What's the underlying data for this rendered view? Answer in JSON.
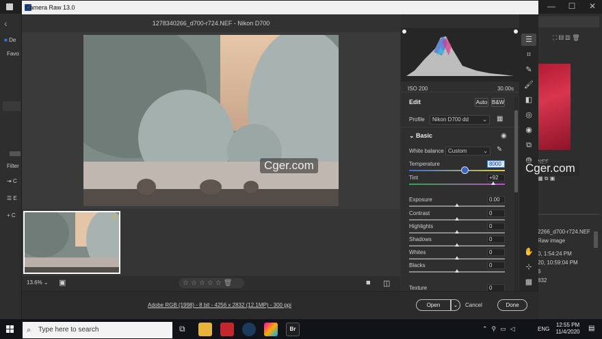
{
  "window": {
    "title": "Camera Raw 13.0",
    "filename": "1278340266_d700-r724.NEF  -  Nikon D700"
  },
  "bridge": {
    "left_items": [
      "De",
      "Favo",
      "Filter",
      "C",
      "E",
      "C"
    ],
    "right_meta": [
      "2266_d700-r724.NEF",
      "Raw image",
      "0, 1:54:24 PM",
      "20, 10:59:04 PM",
      "6",
      "832"
    ],
    "thumb_caption": "NEF"
  },
  "watermark": "Cger.com",
  "filmstrip": {
    "zoom": "13.6%",
    "stars": [
      "☆",
      "☆",
      "☆",
      "☆",
      "☆"
    ]
  },
  "histogram": {
    "iso": "ISO 200",
    "shutter": "30.00s"
  },
  "edit": {
    "heading": "Edit",
    "auto": "Auto",
    "bw": "B&W",
    "profile_label": "Profile",
    "profile_value": "Nikon D700 dd",
    "basic_label": "Basic",
    "wb_label": "White balance",
    "wb_value": "Custom",
    "temperature": {
      "label": "Temperature",
      "value": "8000",
      "level": 0.66
    },
    "tint": {
      "label": "Tint",
      "value": "+92",
      "level": 0.96
    },
    "exposure": {
      "label": "Exposure",
      "value": "0.00",
      "level": 0.5
    },
    "contrast": {
      "label": "Contrast",
      "value": "0",
      "level": 0.5
    },
    "highlights": {
      "label": "Highlights",
      "value": "0",
      "level": 0.5
    },
    "shadows": {
      "label": "Shadows",
      "value": "0",
      "level": 0.5
    },
    "whites": {
      "label": "Whites",
      "value": "0",
      "level": 0.5
    },
    "blacks": {
      "label": "Blacks",
      "value": "0",
      "level": 0.5
    },
    "texture": {
      "label": "Texture",
      "value": "0"
    }
  },
  "footer": {
    "info": "Adobe RGB (1998) - 8 bit - 4256 x 2832 (12.1MP) - 300 ppi",
    "open": "Open",
    "cancel": "Cancel",
    "done": "Done"
  },
  "taskbar": {
    "search": "Type here to search",
    "time": "12:55 PM",
    "date": "11/4/2020",
    "lang": "ENG"
  },
  "colors": {
    "accent": "#2d7bd6",
    "taskbar": "#101317",
    "panel": "#2f2f2f"
  }
}
